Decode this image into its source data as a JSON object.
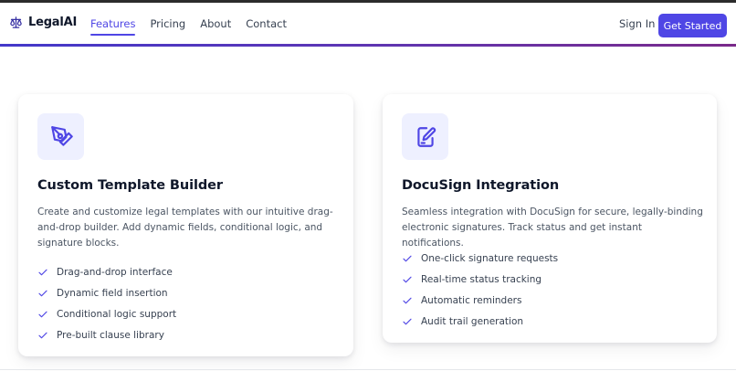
{
  "header": {
    "brand": "LegalAI",
    "nav": [
      {
        "label": "Features",
        "active": true
      },
      {
        "label": "Pricing",
        "active": false
      },
      {
        "label": "About",
        "active": false
      },
      {
        "label": "Contact",
        "active": false
      }
    ],
    "sign_in": "Sign In",
    "cta": "Get Started"
  },
  "cards": [
    {
      "icon": "pen-tool-icon",
      "title": "Custom Template Builder",
      "description": "Create and customize legal templates with our intuitive drag-and-drop builder. Add dynamic fields, conditional logic, and signature blocks.",
      "features": [
        "Drag-and-drop interface",
        "Dynamic field insertion",
        "Conditional logic support",
        "Pre-built clause library"
      ]
    },
    {
      "icon": "file-signature-icon",
      "title": "DocuSign Integration",
      "description": "Seamless integration with DocuSign for secure, legally-binding electronic signatures. Track status and get instant notifications.",
      "features": [
        "One-click signature requests",
        "Real-time status tracking",
        "Automatic reminders",
        "Audit trail generation"
      ]
    }
  ],
  "colors": {
    "primary": "#4f46e5",
    "icon_bg": "#eef0ff",
    "text": "#0f172a",
    "muted": "#4b5563"
  }
}
